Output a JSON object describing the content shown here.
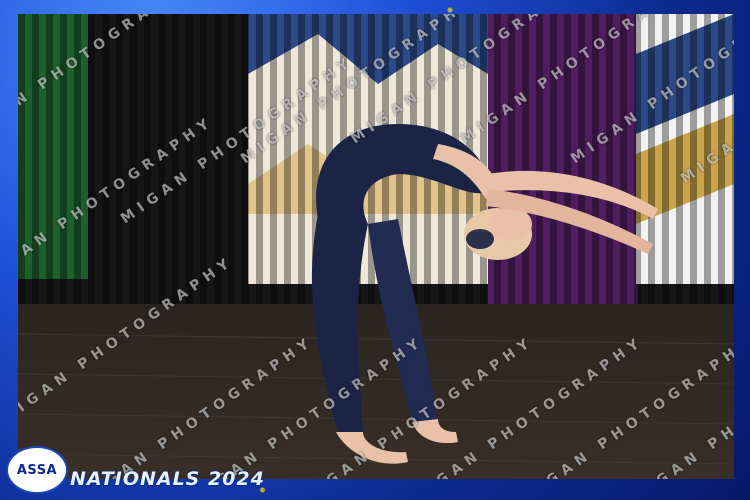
{
  "photo": {
    "subject": "dancer-backbend",
    "colors": {
      "border_blue": "#1f4fd6",
      "leotard": "#1c2446",
      "skin": "#e9c1a8",
      "hair": "#e8c9a6"
    }
  },
  "watermark": {
    "text": "MIGAN PHOTOGRAPHY"
  },
  "logo": {
    "text": "ASSA"
  },
  "event": {
    "title": "NATIONALS 2024"
  }
}
